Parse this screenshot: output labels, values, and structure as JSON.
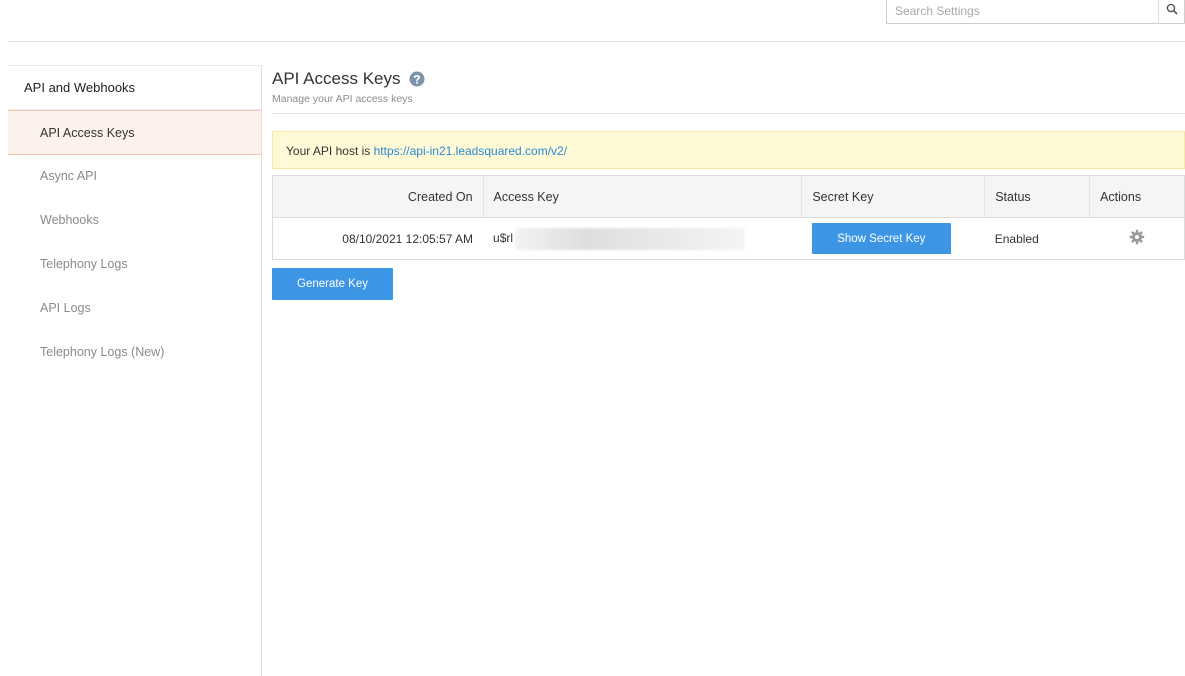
{
  "search": {
    "placeholder": "Search Settings"
  },
  "sidebar": {
    "heading": "API and Webhooks",
    "items": [
      {
        "label": "API Access Keys",
        "active": true
      },
      {
        "label": "Async API"
      },
      {
        "label": "Webhooks"
      },
      {
        "label": "Telephony Logs"
      },
      {
        "label": "API Logs"
      },
      {
        "label": "Telephony Logs (New)"
      }
    ]
  },
  "main": {
    "title": "API Access Keys",
    "subtitle": "Manage your API access keys",
    "banner": {
      "prefix": "Your API host is ",
      "link": "https://api-in21.leadsquared.com/v2/"
    },
    "table": {
      "headers": [
        "Created On",
        "Access Key",
        "Secret Key",
        "Status",
        "Actions"
      ],
      "rows": [
        {
          "created_on": "08/10/2021 12:05:57 AM",
          "access_key": "u$rl",
          "secret_button": "Show Secret Key",
          "status": "Enabled"
        }
      ]
    },
    "generate_button": "Generate Key"
  },
  "colors": {
    "accent": "#3d95e6",
    "active_item_bg": "#fdf1ec",
    "banner_bg": "#fff9d6",
    "link": "#2a8ad4"
  },
  "icons": [
    "search-icon",
    "help-icon",
    "gear-icon"
  ]
}
